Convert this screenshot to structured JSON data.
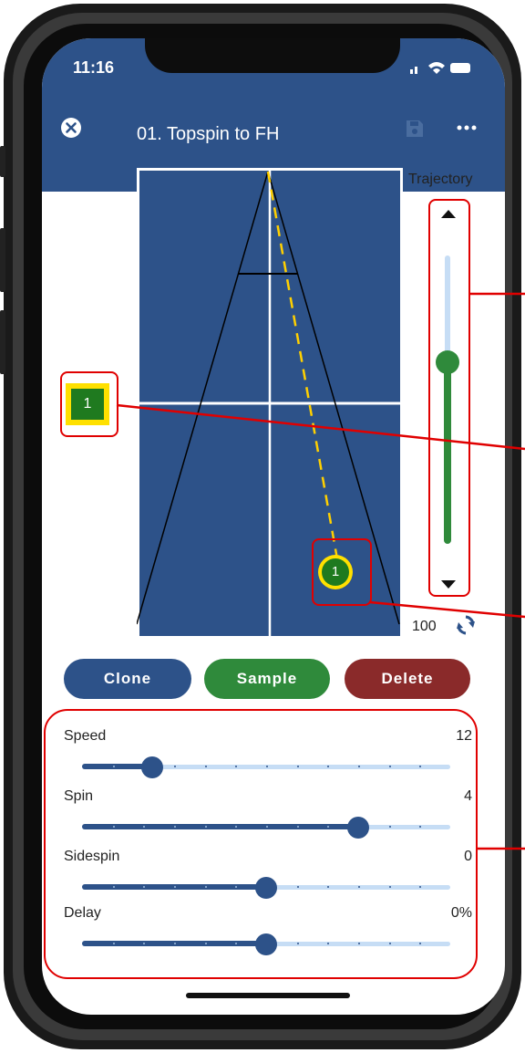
{
  "status_bar": {
    "time": "11:16"
  },
  "header": {
    "title": "01. Topspin to FH",
    "close_icon": "close-circle-icon",
    "save_icon": "save-icon",
    "more_icon": "more-icon"
  },
  "colors": {
    "header": "#2d5289",
    "table": "#2d5289",
    "ball": "#1f7a1f",
    "highlight": "#ffe000",
    "clone": "#2d5289",
    "sample": "#2f8a3b",
    "delete": "#8a2a2a",
    "callout": "#e00000"
  },
  "trajectory": {
    "label": "Trajectory",
    "value_label": "100",
    "level": 0.63,
    "refresh_icon": "refresh-icon",
    "up_icon": "arrow-up-icon",
    "down_icon": "arrow-down-icon"
  },
  "ball_marker": {
    "label": "1"
  },
  "landing_marker": {
    "label": "1"
  },
  "buttons": {
    "clone": "Clone",
    "sample": "Sample",
    "delete": "Delete"
  },
  "controls": [
    {
      "label": "Speed",
      "value": "12",
      "position": 0.19
    },
    {
      "label": "Spin",
      "value": "4",
      "position": 0.75
    },
    {
      "label": "Sidespin",
      "value": "0",
      "position": 0.5
    },
    {
      "label": "Delay",
      "value": "0%",
      "position": 0.5
    }
  ]
}
